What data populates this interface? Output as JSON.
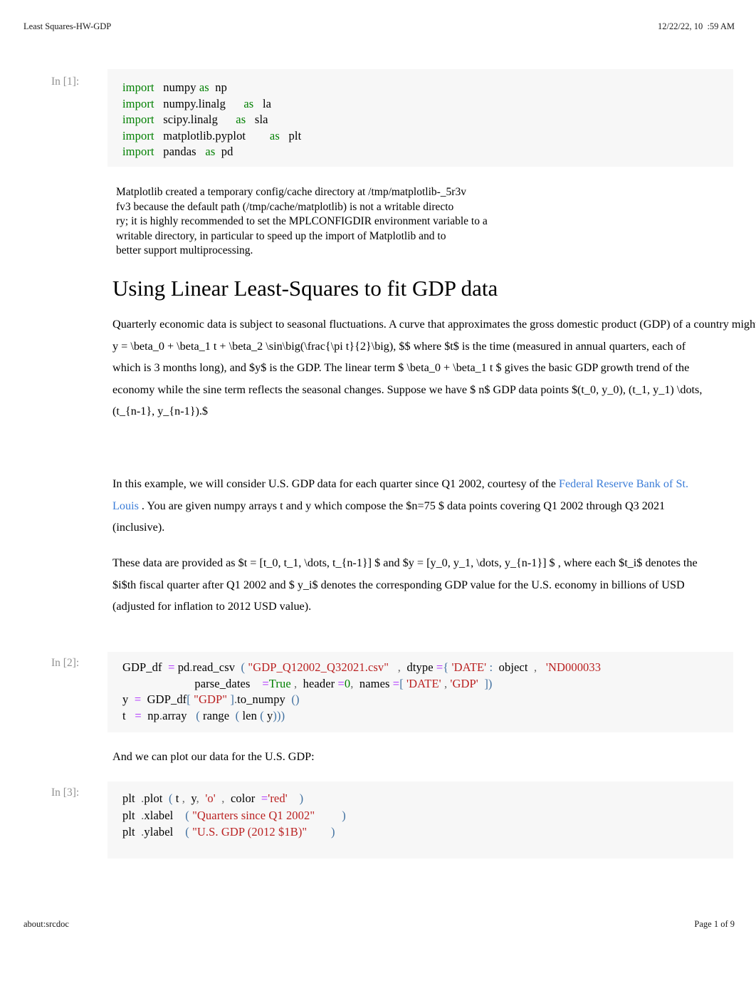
{
  "print": {
    "header_left": "Least Squares-HW-GDP",
    "header_right": "12/22/22, 10  :59 AM",
    "footer_left": "about:srcdoc",
    "footer_right": "Page 1 of 9"
  },
  "colors": {
    "link": "#3b7dd8",
    "keyword": "#008000",
    "string": "#ba2121",
    "operator": "#aa22ff",
    "paren": "#4070a0",
    "prompt": "#919191",
    "cell_bg": "#f7f7f7"
  },
  "cells": {
    "cell1": {
      "prompt": "In [1]:",
      "lines": [
        [
          {
            "t": "import",
            "c": "k"
          },
          {
            "t": "   numpy ",
            "c": "nm"
          },
          {
            "t": "as",
            "c": "k"
          },
          {
            "t": "  np",
            "c": "nm"
          }
        ],
        [
          {
            "t": "import",
            "c": "k"
          },
          {
            "t": "   numpy.linalg      ",
            "c": "nm"
          },
          {
            "t": "as",
            "c": "k"
          },
          {
            "t": "   la",
            "c": "nm"
          }
        ],
        [
          {
            "t": "import",
            "c": "k"
          },
          {
            "t": "   scipy.linalg      ",
            "c": "nm"
          },
          {
            "t": "as",
            "c": "k"
          },
          {
            "t": "   sla",
            "c": "nm"
          }
        ],
        [
          {
            "t": "import",
            "c": "k"
          },
          {
            "t": "   matplotlib.pyplot        ",
            "c": "nm"
          },
          {
            "t": "as",
            "c": "k"
          },
          {
            "t": "   plt",
            "c": "nm"
          }
        ],
        [
          {
            "t": "import",
            "c": "k"
          },
          {
            "t": "   pandas   ",
            "c": "nm"
          },
          {
            "t": "as",
            "c": "k"
          },
          {
            "t": "  pd",
            "c": "nm"
          }
        ]
      ]
    },
    "cell1_output": {
      "text": "Matplotlib created a temporary config/cache directory at /tmp/matplotlib-_5r3v\nfv3 because the default path (/tmp/cache/matplotlib) is not a writable directo\nry; it is highly recommended to set the MPLCONFIGDIR environment variable to a\nwritable directory, in particular to speed up the import of Matplotlib and to\nbetter support multiprocessing."
    },
    "cell2": {
      "prompt": "In [2]:",
      "lines": [
        [
          {
            "t": "GDP_df  ",
            "c": "nm"
          },
          {
            "t": "=",
            "c": "eq"
          },
          {
            "t": " pd",
            "c": "nm"
          },
          {
            "t": ".",
            "c": "op"
          },
          {
            "t": "read_csv  ",
            "c": "nm"
          },
          {
            "t": "(",
            "c": "pn"
          },
          {
            "t": " \"GDP_Q12002_Q32021.csv\"",
            "c": "s"
          },
          {
            "t": "   ",
            "c": "nm"
          },
          {
            "t": ",",
            "c": "op"
          },
          {
            "t": "  dtype ",
            "c": "nm"
          },
          {
            "t": "=",
            "c": "eq"
          },
          {
            "t": "{",
            "c": "pn"
          },
          {
            "t": " 'DATE'",
            "c": "s"
          },
          {
            "t": " :",
            "c": "pn"
          },
          {
            "t": "  object ",
            "c": "nm"
          },
          {
            "t": " ,",
            "c": "op"
          },
          {
            "t": "   'ND000033",
            "c": "s"
          }
        ],
        [
          {
            "t": "                        parse_dates    ",
            "c": "nm"
          },
          {
            "t": "=",
            "c": "eq"
          },
          {
            "t": "True",
            "c": "k"
          },
          {
            "t": " ,",
            "c": "op"
          },
          {
            "t": "  header ",
            "c": "nm"
          },
          {
            "t": "=",
            "c": "eq"
          },
          {
            "t": "0",
            "c": "k"
          },
          {
            "t": ",",
            "c": "op"
          },
          {
            "t": "  names ",
            "c": "nm"
          },
          {
            "t": "=",
            "c": "eq"
          },
          {
            "t": "[",
            "c": "pn"
          },
          {
            "t": " 'DATE'",
            "c": "s"
          },
          {
            "t": " ,",
            "c": "op"
          },
          {
            "t": " 'GDP'",
            "c": "s"
          },
          {
            "t": "  ])",
            "c": "pn"
          }
        ],
        [
          {
            "t": "y  ",
            "c": "nm"
          },
          {
            "t": "=",
            "c": "eq"
          },
          {
            "t": "  GDP_df",
            "c": "nm"
          },
          {
            "t": "[",
            "c": "pn"
          },
          {
            "t": " \"GDP\" ",
            "c": "s"
          },
          {
            "t": "]",
            "c": "pn"
          },
          {
            "t": ".",
            "c": "op"
          },
          {
            "t": "to_numpy  ",
            "c": "nm"
          },
          {
            "t": "()",
            "c": "pn"
          }
        ],
        [
          {
            "t": "t   ",
            "c": "nm"
          },
          {
            "t": "=",
            "c": "eq"
          },
          {
            "t": "  np",
            "c": "nm"
          },
          {
            "t": ".",
            "c": "op"
          },
          {
            "t": "array   ",
            "c": "nm"
          },
          {
            "t": "(",
            "c": "pn"
          },
          {
            "t": " range  ",
            "c": "nm"
          },
          {
            "t": "(",
            "c": "pn"
          },
          {
            "t": " len ",
            "c": "nm"
          },
          {
            "t": "(",
            "c": "pn"
          },
          {
            "t": " y",
            "c": "nm"
          },
          {
            "t": ")))",
            "c": "pn"
          }
        ]
      ]
    },
    "cell3": {
      "prompt": "In [3]:",
      "lines": [
        [
          {
            "t": "plt  ",
            "c": "nm"
          },
          {
            "t": ".",
            "c": "op"
          },
          {
            "t": "plot  ",
            "c": "nm"
          },
          {
            "t": "(",
            "c": "pn"
          },
          {
            "t": " t ",
            "c": "nm"
          },
          {
            "t": ",",
            "c": "op"
          },
          {
            "t": "  y",
            "c": "nm"
          },
          {
            "t": ",",
            "c": "op"
          },
          {
            "t": "  'o'",
            "c": "s"
          },
          {
            "t": "  ,",
            "c": "op"
          },
          {
            "t": "  color  ",
            "c": "nm"
          },
          {
            "t": "=",
            "c": "eq"
          },
          {
            "t": "'red'",
            "c": "s"
          },
          {
            "t": "    )",
            "c": "pn"
          }
        ],
        [
          {
            "t": "plt  ",
            "c": "nm"
          },
          {
            "t": ".",
            "c": "op"
          },
          {
            "t": "xlabel    ",
            "c": "nm"
          },
          {
            "t": "(",
            "c": "pn"
          },
          {
            "t": " \"Quarters since Q1 2002\"",
            "c": "s"
          },
          {
            "t": "         )",
            "c": "pn"
          }
        ],
        [
          {
            "t": "plt  ",
            "c": "nm"
          },
          {
            "t": ".",
            "c": "op"
          },
          {
            "t": "ylabel    ",
            "c": "nm"
          },
          {
            "t": "(",
            "c": "pn"
          },
          {
            "t": " \"U.S. GDP (2012 $1B)\"",
            "c": "s"
          },
          {
            "t": "        )",
            "c": "pn"
          }
        ]
      ]
    }
  },
  "markdown": {
    "heading": "Using Linear Least-Squares to fit GDP data",
    "para1_a": "Quarterly economic data is subject to seasonal fluctuations. A curve that approximates the gross domestic product (GDP) of a country might be of the form ",
    "para1_math1": "$$  y = \\beta_0 + \\beta_1 t + \\beta_2 \\sin\\big(\\frac{\\pi t}{2}\\big),      $$",
    "para1_b": "  where   $t$  is the time (measured in annual quarters, each of which is 3 months long), and ",
    "para1_math2": "$y$",
    "para1_c": "  is the GDP. The linear term ",
    "para1_math3": "$ \\beta_0 + \\beta_1 t    $",
    "para1_d": "  gives the basic GDP growth trend of the economy while the sine term reflects the seasonal changes. Suppose we have ",
    "para1_math4": "$ n$",
    "para1_e": "  GDP data points ",
    "para1_math5": "$(t_0, y_0), (t_1, y_1) \\dots, (t_{n-1}, y_{n-1}).$",
    "para2_a": "In this example, we will consider U.S. GDP data for each quarter since Q1 2002, courtesy of the ",
    "para2_link": "Federal Reserve Bank of St. Louis",
    "para2_b": "   . You are given numpy arrays ",
    "para2_code1": "t",
    "para2_c": "  and ",
    "para2_code2": "y",
    "para2_d": "  which compose the ",
    "para2_math1": "$n=75 $",
    "para2_e": " data points covering Q1 2002 through Q3 2021 (inclusive).",
    "para3_a": "These data are provided as ",
    "para3_math1": "$t = [t_0, t_1, \\dots, t_{n-1}]     $",
    "para3_b": " and ",
    "para3_math2": "$y = [y_0, y_1, \\dots, y_{n-1}]    $",
    "para3_c": " , where each ",
    "para3_math3": "$t_i$",
    "para3_d": " denotes the ",
    "para3_math4": "$i$",
    "para3_e": "th fiscal quarter after Q1 2002 and ",
    "para3_math5": "$ y_i$",
    "para3_f": "  denotes the corresponding GDP value for the U.S. economy in billions of USD (adjusted for inflation to 2012 USD value).",
    "para4": "And we can plot our data for the U.S. GDP:"
  }
}
